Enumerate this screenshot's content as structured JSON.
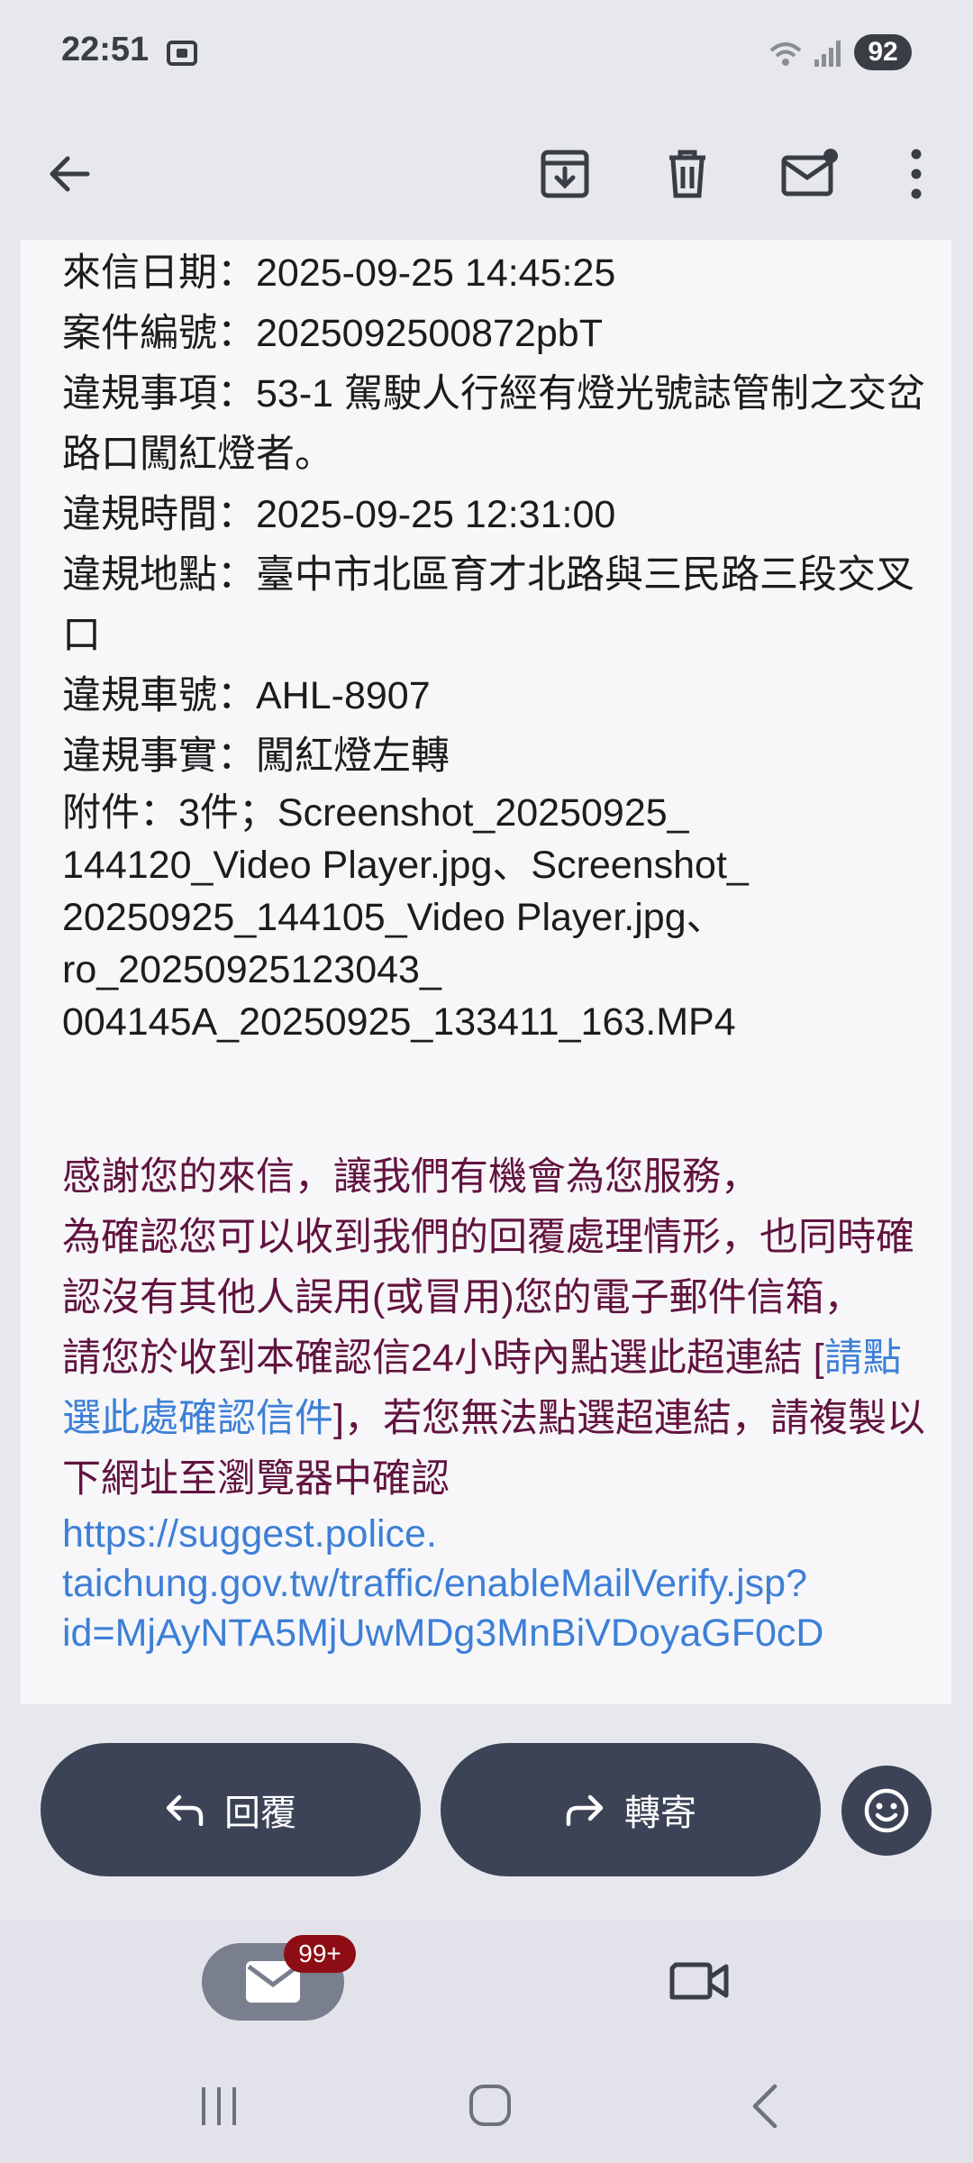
{
  "status_bar": {
    "time": "22:51",
    "battery": "92",
    "icons": [
      "screenshot-icon",
      "wifi-icon",
      "signal-icon",
      "battery-icon"
    ]
  },
  "toolbar": {
    "icons": [
      "back-arrow-icon",
      "archive-icon",
      "delete-icon",
      "mark-unread-icon",
      "more-vert-icon"
    ]
  },
  "email": {
    "date_line": "來信日期：2025-09-25 14:45:25",
    "case_line": "案件編號：2025092500872pbT",
    "violation_item_line": "違規事項：53-1 駕駛人行經有燈光號誌管制之交岔路口闖紅燈者。",
    "violation_time_line": "違規時間：2025-09-25 12:31:00",
    "violation_place_line": "違規地點：臺中市北區育才北路與三民路三段交叉口",
    "plate_line": "違規車號：AHL-8907",
    "fact_line": "違規事實：闖紅燈左轉",
    "attachments_line": "附件：3件；Screenshot_20250925_ 144120_Video Player.jpg、Screenshot_ 20250925_144105_Video Player.jpg、 ro_20250925123043_ 004145A_20250925_133411_163.MP4",
    "thanks": "感謝您的來信，讓我們有機會為您服務，",
    "confirm_text": "為確認您可以收到我們的回覆處理情形，也同時確認沒有其他人誤用(或冒用)您的電子郵件信箱，",
    "instruct_prefix": "請您於收到本確認信24小時內點選此超連結 [",
    "confirm_link": "請點選此處確認信件",
    "instruct_suffix": "]，若您無法點選超連結，請複製以下網址至瀏覽器中確認",
    "url": "https://suggest.police. taichung.gov.tw/traffic/enableMailVerify.jsp? id=MjAyNTA5MjUwMDg3MnBiVDoyaGF0cD"
  },
  "actions": {
    "reply_label": "回覆",
    "forward_label": "轉寄"
  },
  "bottom_nav": {
    "mail_badge": "99+"
  },
  "colors": {
    "purple_text": "#62133f",
    "link_blue": "#3d7fd6",
    "button_dark": "#3c4356",
    "badge_red": "#8e0d14"
  }
}
